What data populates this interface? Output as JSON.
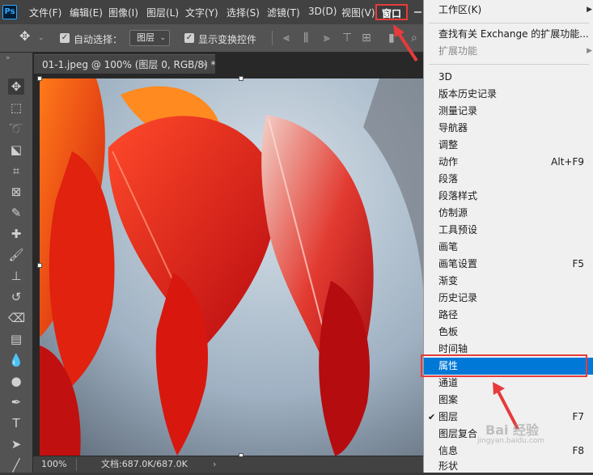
{
  "menubar": {
    "logo": "Ps",
    "items": [
      "文件(F)",
      "编辑(E)",
      "图像(I)",
      "图层(L)",
      "文字(Y)",
      "选择(S)",
      "滤镜(T)",
      "3D(D)",
      "视图(V)"
    ],
    "active_item": "窗口"
  },
  "options": {
    "auto_select_label": "自动选择：",
    "auto_select_value": "图层",
    "show_transform_label": "显示变换控件"
  },
  "document": {
    "tab_title": "01-1.jpeg @ 100% (图层 0, RGB/8) *",
    "tab_close": "×",
    "zoom": "100%",
    "doc_info": "文档:687.0K/687.0K",
    "status_arrow": "›"
  },
  "window_menu": {
    "items": [
      {
        "label": "工作区(K)",
        "submenu": true
      },
      {
        "label": "查找有关 Exchange 的扩展功能..."
      },
      {
        "label": "扩展功能",
        "submenu": true,
        "disabled": true
      },
      {
        "label": "3D"
      },
      {
        "label": "版本历史记录"
      },
      {
        "label": "测量记录"
      },
      {
        "label": "导航器"
      },
      {
        "label": "调整"
      },
      {
        "label": "动作",
        "shortcut": "Alt+F9"
      },
      {
        "label": "段落"
      },
      {
        "label": "段落样式"
      },
      {
        "label": "仿制源"
      },
      {
        "label": "工具预设"
      },
      {
        "label": "画笔"
      },
      {
        "label": "画笔设置",
        "shortcut": "F5"
      },
      {
        "label": "渐变"
      },
      {
        "label": "历史记录"
      },
      {
        "label": "路径"
      },
      {
        "label": "色板"
      },
      {
        "label": "时间轴"
      },
      {
        "label": "属性",
        "highlighted": true
      },
      {
        "label": "通道"
      },
      {
        "label": "图案"
      },
      {
        "label": "图层",
        "shortcut": "F7",
        "checked": true
      },
      {
        "label": "图层复合"
      },
      {
        "label": "信息",
        "shortcut": "F8"
      },
      {
        "label": "形状"
      }
    ]
  },
  "watermark": {
    "text": "Bai 经验",
    "url": "jingyan.baidu.com"
  },
  "colors": {
    "accent": "#0078d7",
    "annotation": "#e63b3b"
  }
}
